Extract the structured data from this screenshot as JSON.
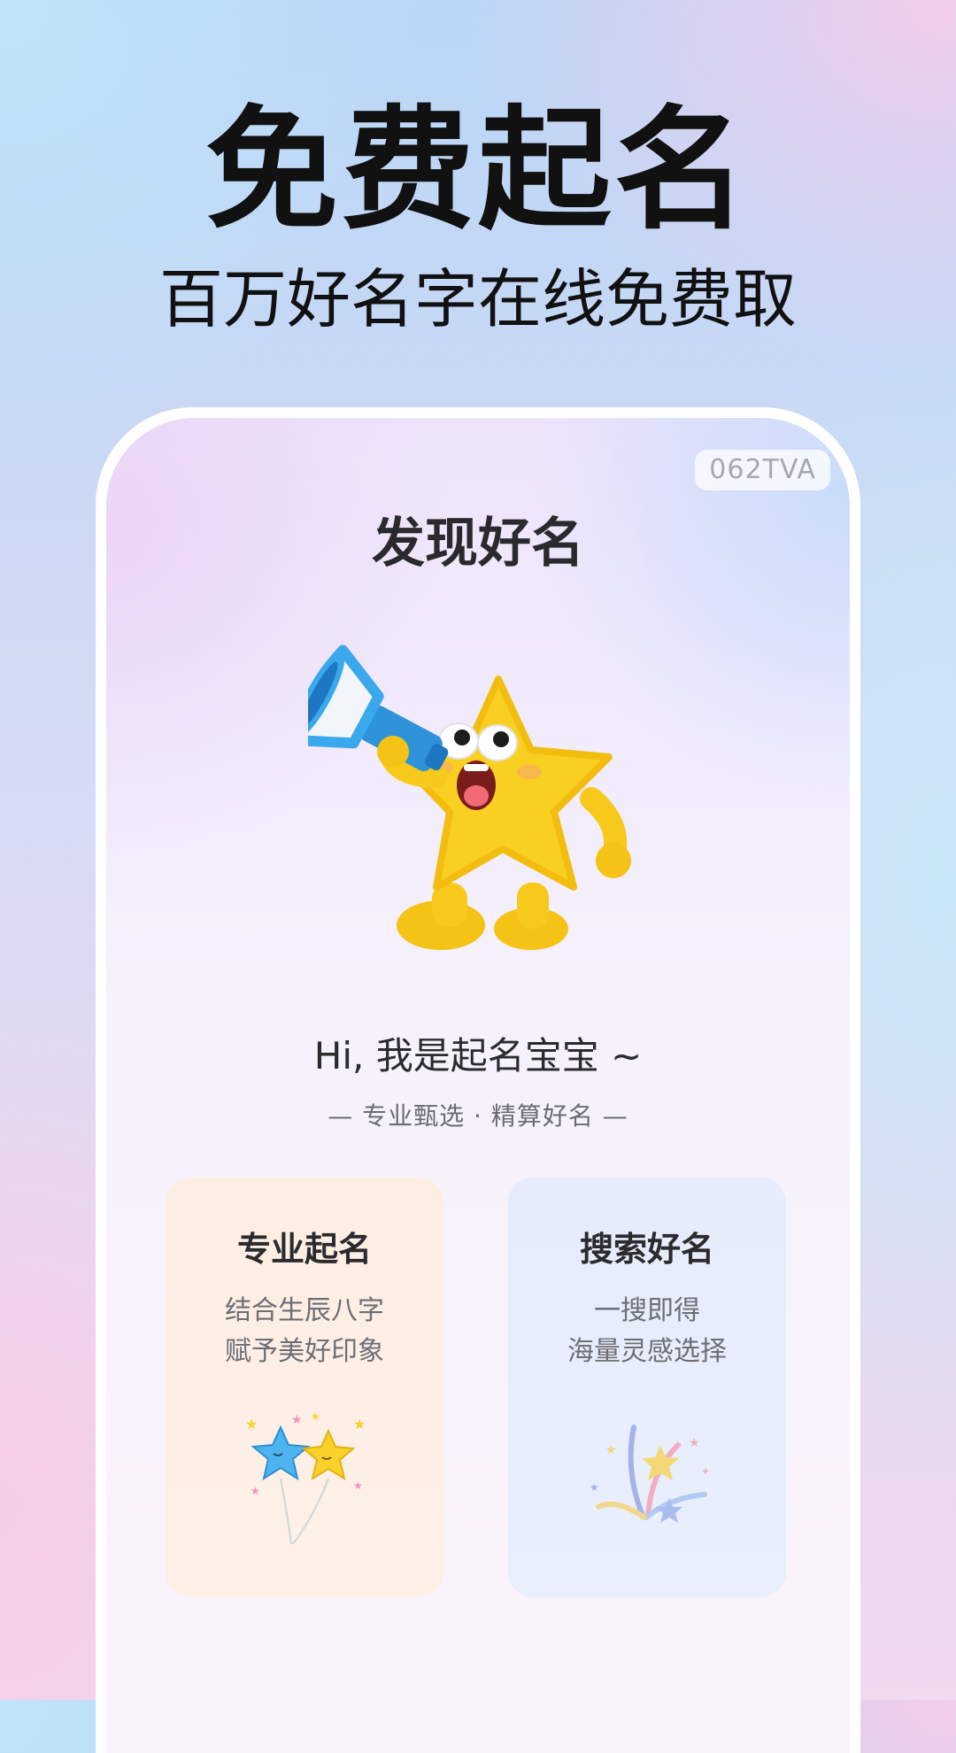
{
  "hero": {
    "title": "免费起名",
    "subtitle": "百万好名字在线免费取"
  },
  "screen": {
    "badge": "062TVA",
    "title": "发现好名",
    "greeting": "Hi, 我是起名宝宝 ~",
    "slogan": "— 专业甄选 · 精算好名 —",
    "mascot_icon": "star-mascot-with-megaphone"
  },
  "cards": [
    {
      "title": "专业起名",
      "line1": "结合生辰八字",
      "line2": "赋予美好印象",
      "icon": "star-balloons-icon"
    },
    {
      "title": "搜索好名",
      "line1": "一搜即得",
      "line2": "海量灵感选择",
      "icon": "fireworks-stars-icon"
    }
  ],
  "colors": {
    "mascot_yellow": "#f7cb1c",
    "megaphone_blue": "#38a6e8",
    "card_pro_bg": "#fdeee4",
    "card_search_bg": "#e6ecfb"
  }
}
